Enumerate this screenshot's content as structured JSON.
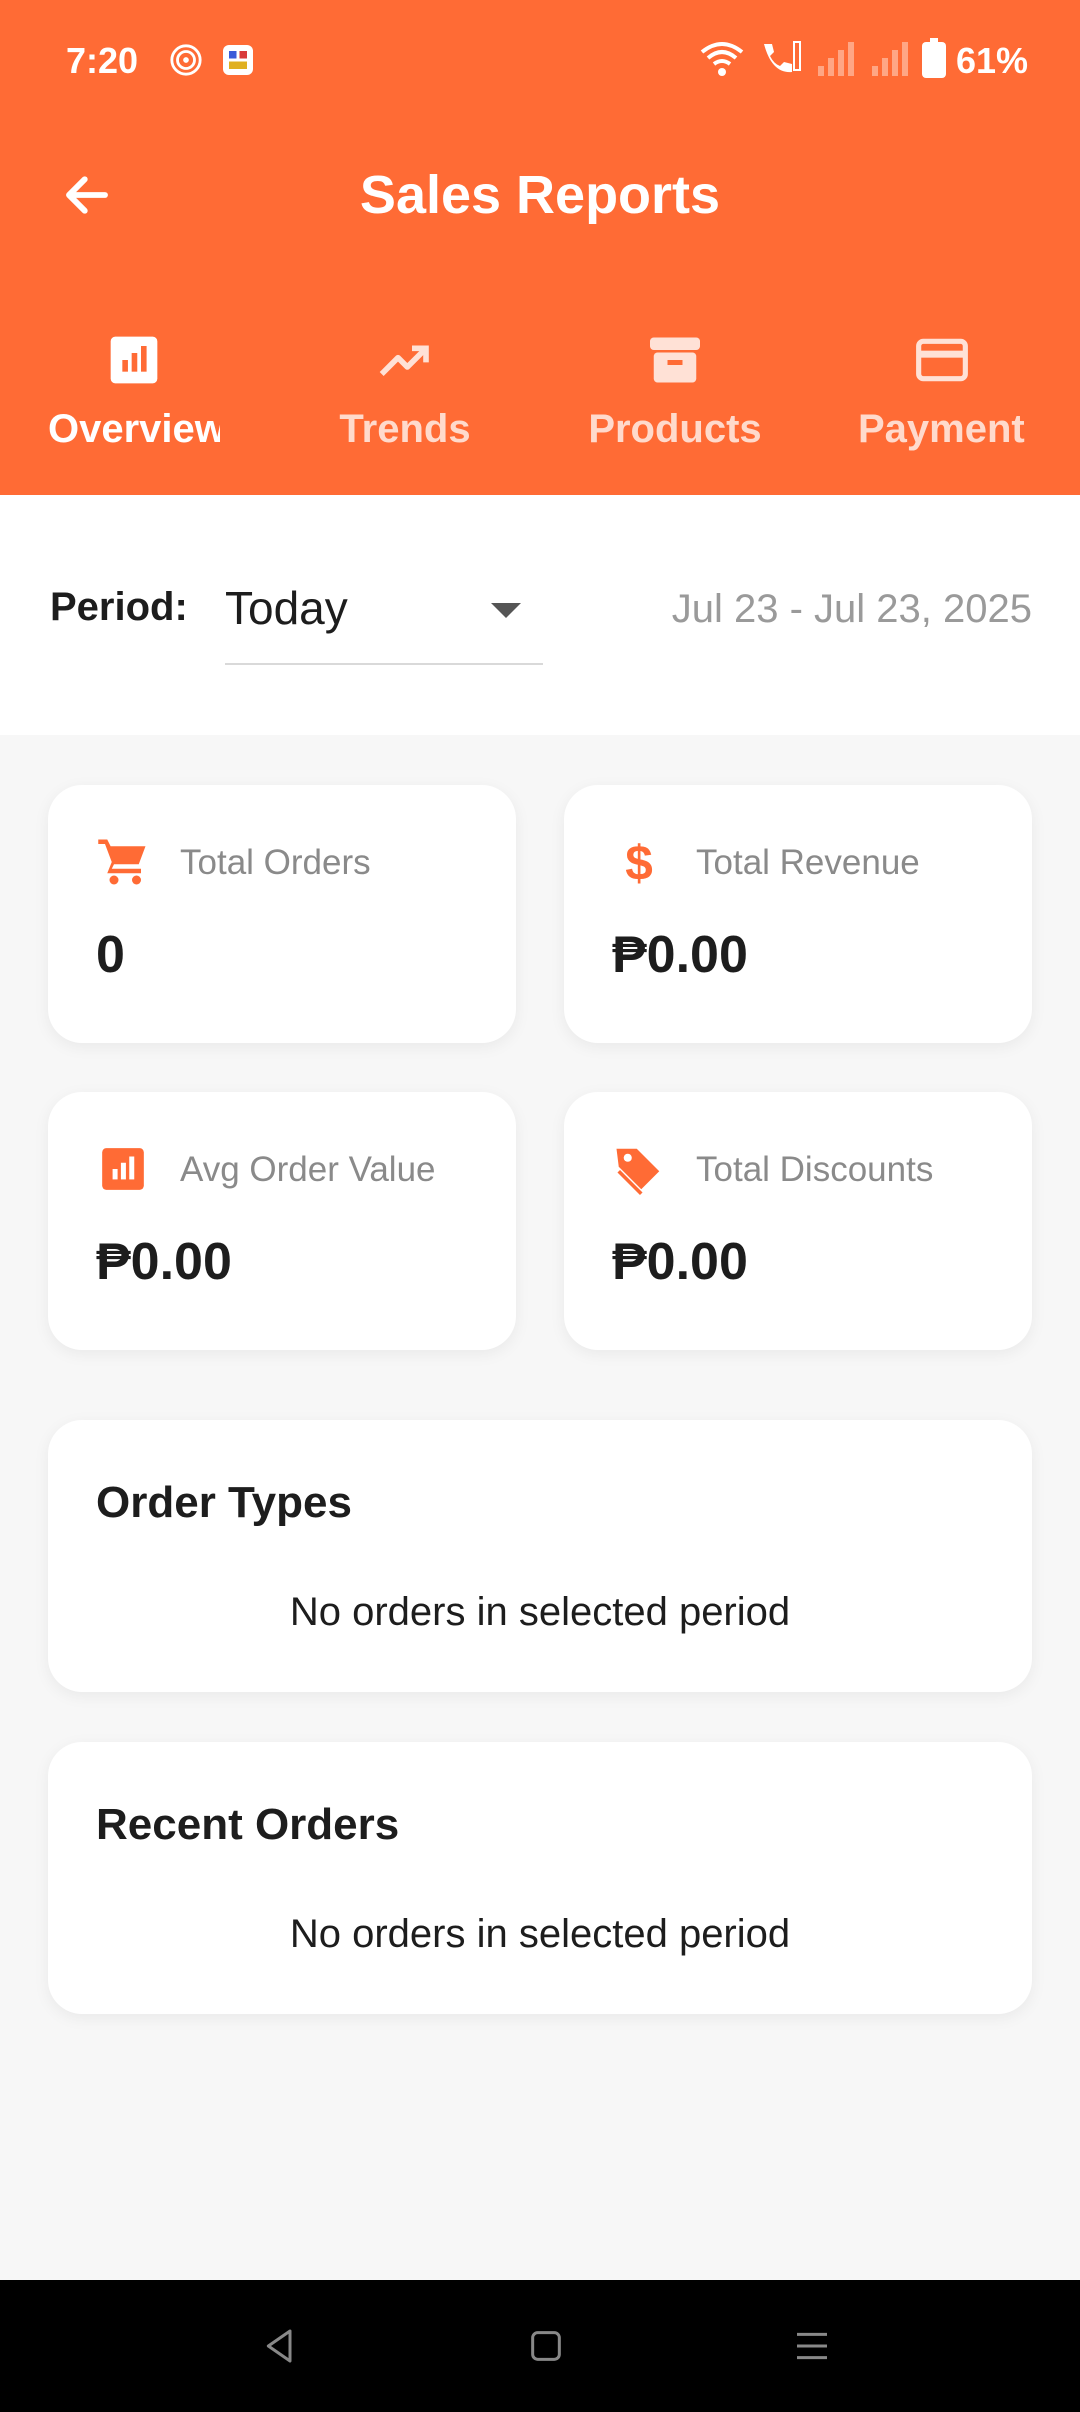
{
  "status_bar": {
    "time": "7:20",
    "battery_text": "61%"
  },
  "app_bar": {
    "title": "Sales Reports"
  },
  "tabs": [
    {
      "label": "Overview",
      "icon": "bar-chart-icon",
      "active": true
    },
    {
      "label": "Trends",
      "icon": "trending-up-icon",
      "active": false
    },
    {
      "label": "Products",
      "icon": "archive-box-icon",
      "active": false
    },
    {
      "label": "Payment",
      "icon": "credit-card-icon",
      "active": false
    }
  ],
  "period": {
    "label": "Period:",
    "value": "Today",
    "date_range": "Jul 23 - Jul 23, 2025"
  },
  "stats": {
    "total_orders": {
      "label": "Total Orders",
      "value": "0",
      "icon": "cart-icon"
    },
    "total_revenue": {
      "label": "Total Revenue",
      "value": "₱0.00",
      "icon": "dollar-icon"
    },
    "avg_order_value": {
      "label": "Avg Order Value",
      "value": "₱0.00",
      "icon": "bar-chart-icon"
    },
    "total_discounts": {
      "label": "Total Discounts",
      "value": "₱0.00",
      "icon": "tag-icon"
    }
  },
  "sections": {
    "order_types": {
      "title": "Order Types",
      "empty_text": "No orders in selected period"
    },
    "recent_orders": {
      "title": "Recent Orders",
      "empty_text": "No orders in selected period"
    }
  },
  "colors": {
    "accent": "#ff6b35",
    "background": "#f7f7f7",
    "text_primary": "#1d1d1d",
    "text_secondary": "#8a8a8a"
  }
}
